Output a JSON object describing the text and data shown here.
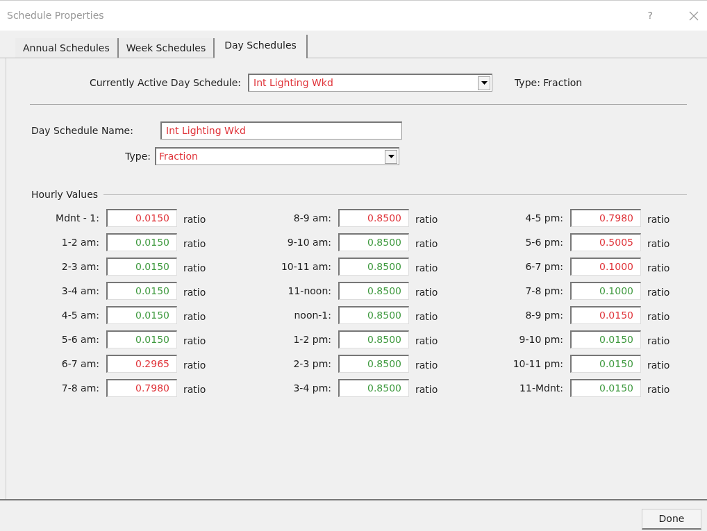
{
  "window": {
    "title": "Schedule Properties",
    "help": "?"
  },
  "tabs": [
    {
      "label": "Annual Schedules",
      "selected": false
    },
    {
      "label": "Week Schedules",
      "selected": false
    },
    {
      "label": "Day Schedules",
      "selected": true
    }
  ],
  "active_schedule": {
    "label": "Currently Active Day Schedule:",
    "value": "Int Lighting Wkd",
    "type_text": "Type: Fraction"
  },
  "schedule_name": {
    "label": "Day Schedule Name:",
    "value": "Int Lighting Wkd"
  },
  "type": {
    "label": "Type:",
    "value": "Fraction"
  },
  "hourly_values": {
    "title": "Hourly Values",
    "items": [
      {
        "label": "Mdnt - 1:",
        "value": "0.0150",
        "unit": "ratio",
        "color": "#e0353b"
      },
      {
        "label": "1-2 am:",
        "value": "0.0150",
        "unit": "ratio",
        "color": "#3f9a3f"
      },
      {
        "label": "2-3 am:",
        "value": "0.0150",
        "unit": "ratio",
        "color": "#3f9a3f"
      },
      {
        "label": "3-4 am:",
        "value": "0.0150",
        "unit": "ratio",
        "color": "#3f9a3f"
      },
      {
        "label": "4-5 am:",
        "value": "0.0150",
        "unit": "ratio",
        "color": "#3f9a3f"
      },
      {
        "label": "5-6 am:",
        "value": "0.0150",
        "unit": "ratio",
        "color": "#3f9a3f"
      },
      {
        "label": "6-7 am:",
        "value": "0.2965",
        "unit": "ratio",
        "color": "#e0353b"
      },
      {
        "label": "7-8 am:",
        "value": "0.7980",
        "unit": "ratio",
        "color": "#e0353b"
      },
      {
        "label": "8-9 am:",
        "value": "0.8500",
        "unit": "ratio",
        "color": "#e0353b"
      },
      {
        "label": "9-10 am:",
        "value": "0.8500",
        "unit": "ratio",
        "color": "#3f9a3f"
      },
      {
        "label": "10-11 am:",
        "value": "0.8500",
        "unit": "ratio",
        "color": "#3f9a3f"
      },
      {
        "label": "11-noon:",
        "value": "0.8500",
        "unit": "ratio",
        "color": "#3f9a3f"
      },
      {
        "label": "noon-1:",
        "value": "0.8500",
        "unit": "ratio",
        "color": "#3f9a3f"
      },
      {
        "label": "1-2 pm:",
        "value": "0.8500",
        "unit": "ratio",
        "color": "#3f9a3f"
      },
      {
        "label": "2-3 pm:",
        "value": "0.8500",
        "unit": "ratio",
        "color": "#3f9a3f"
      },
      {
        "label": "3-4 pm:",
        "value": "0.8500",
        "unit": "ratio",
        "color": "#3f9a3f"
      },
      {
        "label": "4-5 pm:",
        "value": "0.7980",
        "unit": "ratio",
        "color": "#e0353b"
      },
      {
        "label": "5-6 pm:",
        "value": "0.5005",
        "unit": "ratio",
        "color": "#e0353b"
      },
      {
        "label": "6-7 pm:",
        "value": "0.1000",
        "unit": "ratio",
        "color": "#e0353b"
      },
      {
        "label": "7-8 pm:",
        "value": "0.1000",
        "unit": "ratio",
        "color": "#3f9a3f"
      },
      {
        "label": "8-9 pm:",
        "value": "0.0150",
        "unit": "ratio",
        "color": "#e0353b"
      },
      {
        "label": "9-10 pm:",
        "value": "0.0150",
        "unit": "ratio",
        "color": "#3f9a3f"
      },
      {
        "label": "10-11 pm:",
        "value": "0.0150",
        "unit": "ratio",
        "color": "#3f9a3f"
      },
      {
        "label": "11-Mdnt:",
        "value": "0.0150",
        "unit": "ratio",
        "color": "#3f9a3f"
      }
    ]
  },
  "buttons": [
    {
      "label": "Done"
    }
  ]
}
